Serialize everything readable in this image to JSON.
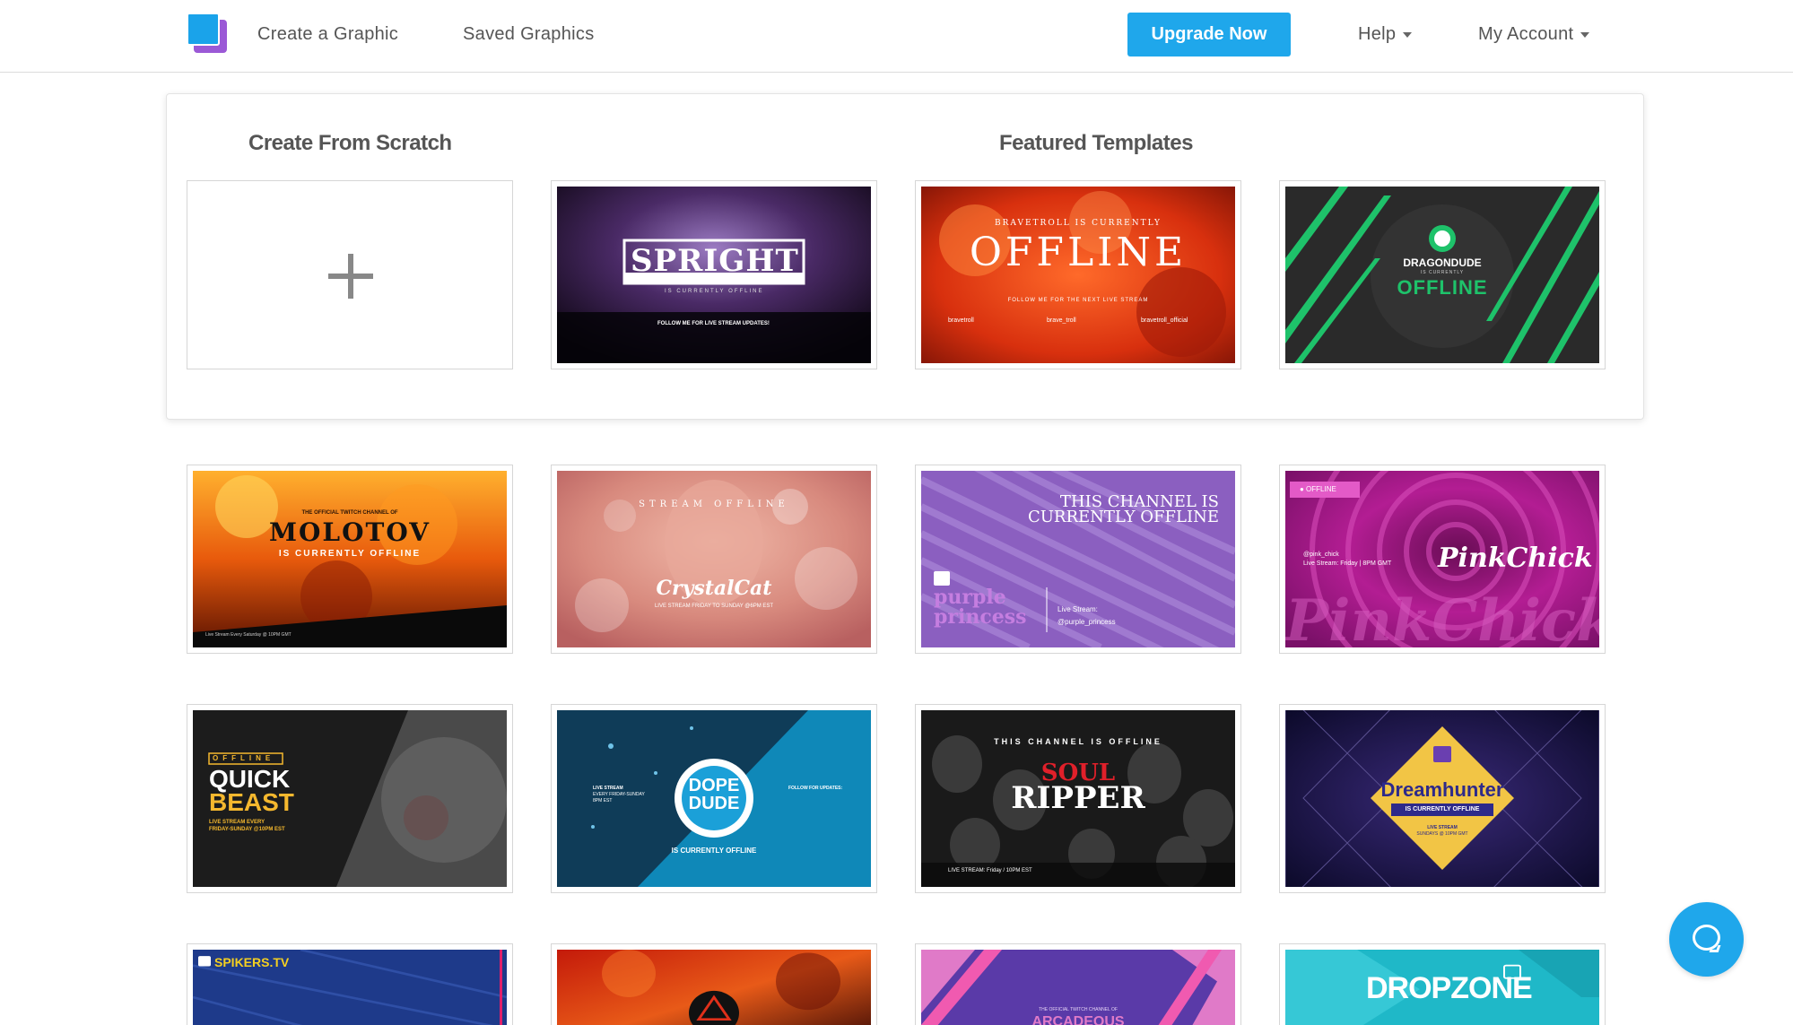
{
  "nav": {
    "create_graphic": "Create a Graphic",
    "saved_graphics": "Saved Graphics",
    "upgrade": "Upgrade Now",
    "help": "Help",
    "my_account": "My Account"
  },
  "panel": {
    "scratch_title": "Create From Scratch",
    "featured_title": "Featured Templates"
  },
  "templates": {
    "spright": {
      "title": "SPRIGHT",
      "sub": "IS CURRENTLY OFFLINE",
      "follow": "FOLLOW ME FOR LIVE STREAM UPDATES!"
    },
    "bravetroll": {
      "top": "BRAVETROLL IS CURRENTLY",
      "title": "OFFLINE",
      "follow": "FOLLOW ME FOR THE NEXT LIVE STREAM",
      "s1": "bravetroll",
      "s2": "brave_troll",
      "s3": "bravetroll_official"
    },
    "dragondude": {
      "name": "DRAGONDUDE",
      "sub": "IS CURRENTLY",
      "title": "OFFLINE"
    },
    "molotov": {
      "top": "THE OFFICIAL TWITCH CHANNEL OF",
      "title": "MOLOTOV",
      "sub": "IS CURRENTLY OFFLINE",
      "foot": "Live Stream Every Saturday @ 10PM GMT"
    },
    "crystalcat": {
      "top": "STREAM OFFLINE",
      "title": "CrystalCat",
      "sub": "LIVE STREAM FRIDAY TO SUNDAY @6PM EST"
    },
    "purple": {
      "line1": "THIS CHANNEL IS",
      "line2": "CURRENTLY OFFLINE",
      "name1": "purple",
      "name2": "princess",
      "stream": "Live Stream:",
      "handle": "@purple_princess"
    },
    "pinkchick": {
      "badge": "● OFFLINE",
      "title": "PinkChick",
      "handle": "@pink_chick",
      "stream": "Live Stream: Friday | 8PM GMT"
    },
    "quickbeast": {
      "badge": "OFFLINE",
      "line1": "QUICK",
      "line2": "BEAST",
      "sub1": "LIVE STREAM EVERY",
      "sub2": "FRIDAY-SUNDAY @10PM EST"
    },
    "dopedude": {
      "line1": "DOPE",
      "line2": "DUDE",
      "sub": "IS CURRENTLY OFFLINE",
      "left1": "LIVE STREAM",
      "left2": "EVERY FRIDAY-SUNDAY",
      "left3": "8PM EST",
      "right1": "FOLLOW FOR UPDATES:"
    },
    "soulripper": {
      "top": "THIS CHANNEL IS OFFLINE",
      "line1": "SOUL",
      "line2": "RIPPER",
      "foot": "LIVE STREAM: Friday / 10PM EST"
    },
    "dreamhunter": {
      "title": "Dreamhunter",
      "sub": "IS CURRENTLY OFFLINE",
      "foot1": "LIVE STREAM",
      "foot2": "SUNDAYS @ 10PM GMT"
    },
    "spikers": {
      "title": "SPIKERS.TV"
    },
    "arcadeous": {
      "top": "THE OFFICIAL TWITCH CHANNEL OF",
      "title": "ARCADEOUS"
    },
    "dropzone": {
      "title": "DROPZONE"
    }
  }
}
